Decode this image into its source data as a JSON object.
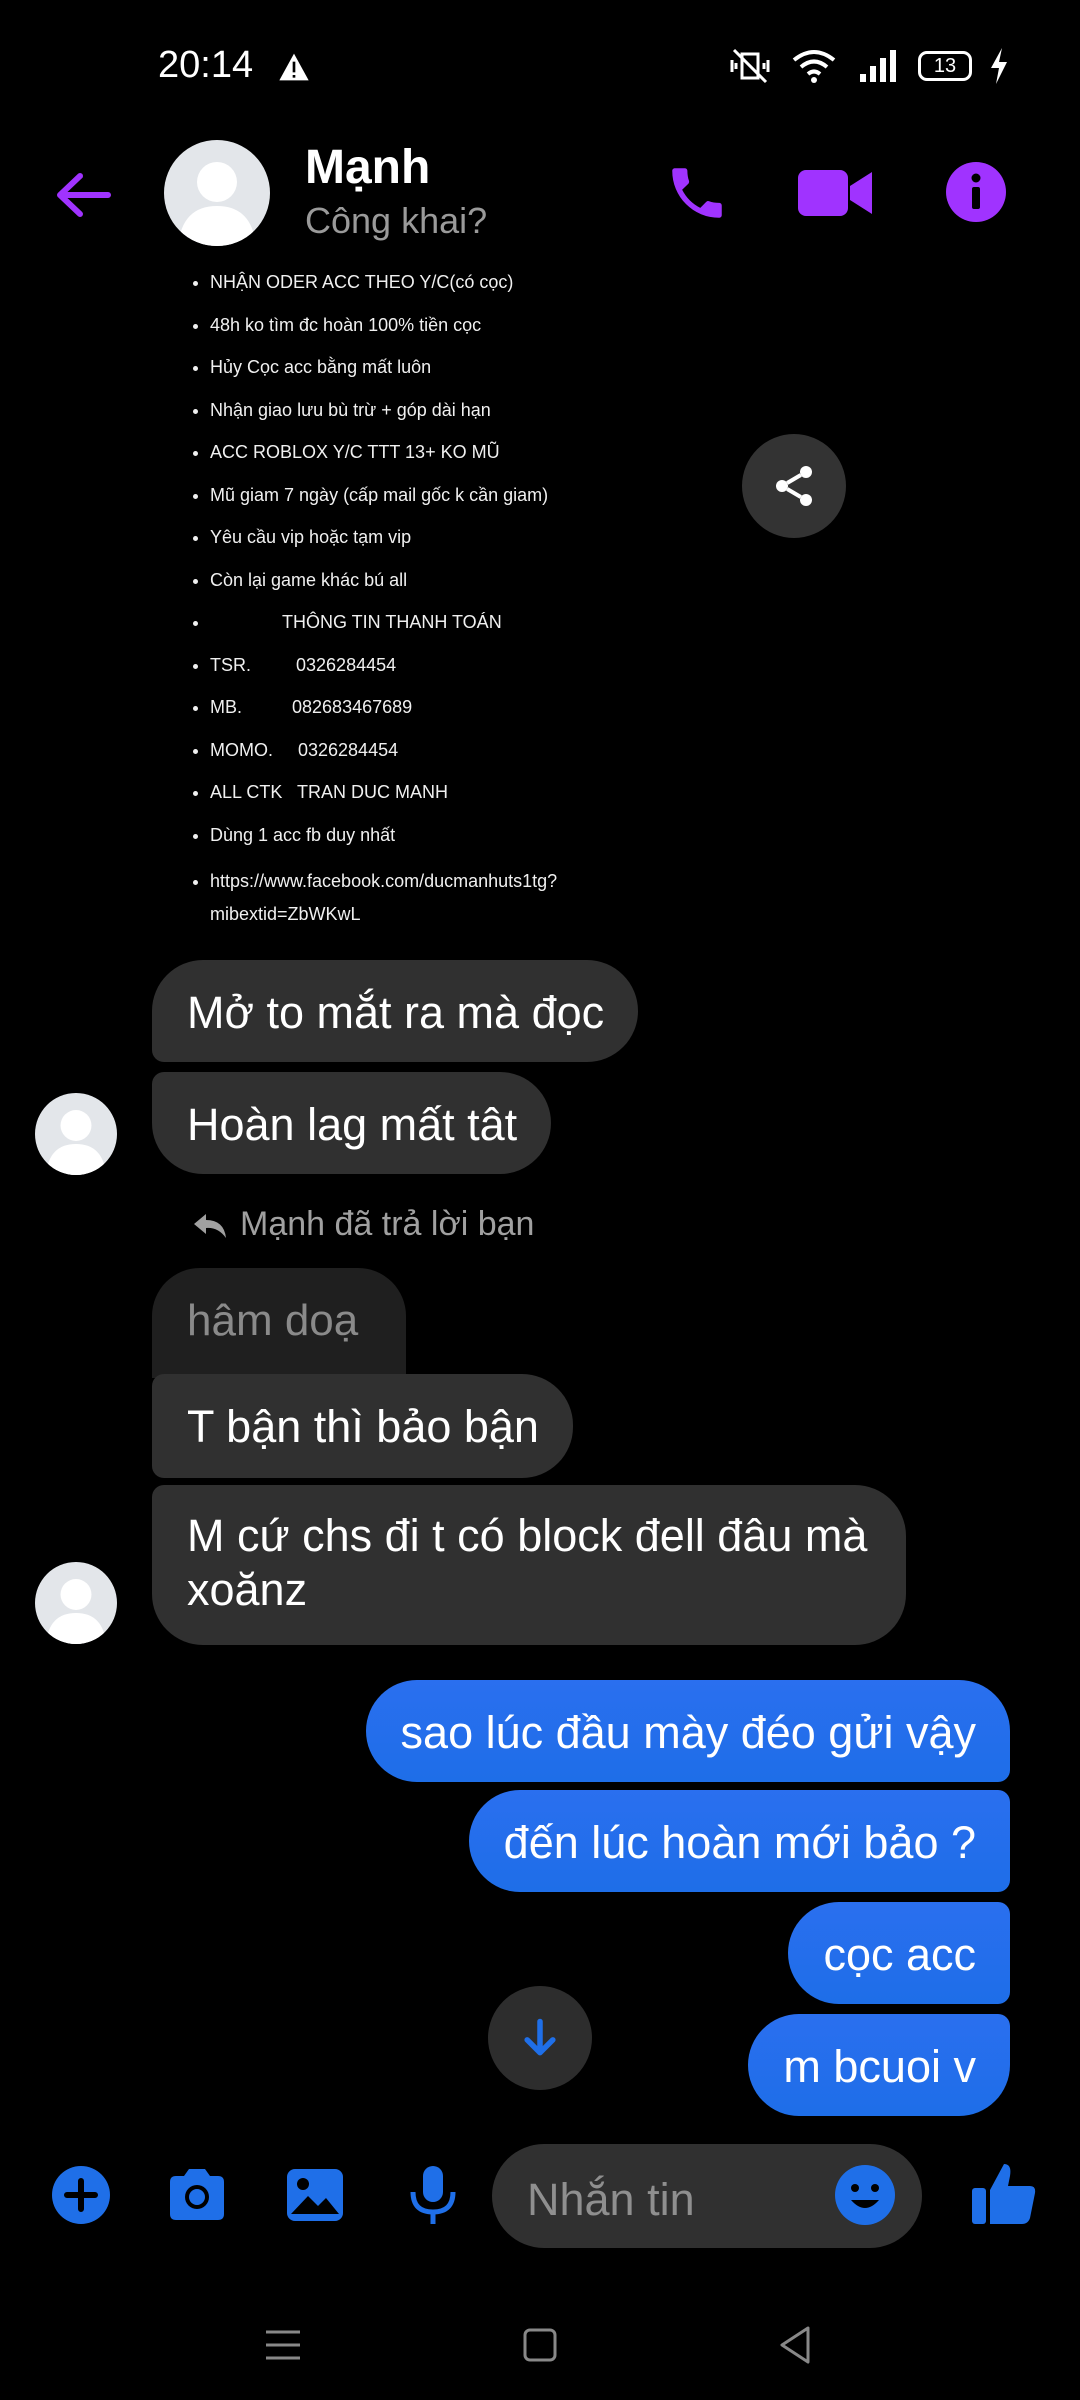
{
  "status_bar": {
    "time": "20:14",
    "battery": "13"
  },
  "header": {
    "name": "Mạnh",
    "subtitle": "Công khai?"
  },
  "shared_post": {
    "lines": [
      "NHẬN ODER ACC THEO Y/C(có cọc)",
      "48h ko tìm đc hoàn 100% tiền cọc",
      "Hủy Cọc acc bằng mất luôn",
      "Nhận giao lưu bù trừ + góp dài hạn",
      "ACC ROBLOX Y/C TTT 13+ KO MŨ",
      "Mũ giam 7 ngày (cấp mail gốc k cần giam)",
      "Yêu cầu vip hoặc tạm vip",
      "Còn lại game khác bú all",
      "THÔNG TIN THANH TOÁN",
      "TSR.         0326284454",
      "MB.          082683467689",
      "MOMO.     0326284454",
      "ALL CTK   TRAN DUC MANH",
      "Dùng 1 acc fb duy nhất",
      "https://www.facebook.com/ducmanhuts1tg?mibextid=ZbWKwL"
    ]
  },
  "messages": {
    "in_1": "Mở to mắt ra mà đọc",
    "in_2": "Hoàn lag mất tât",
    "reply_label": "Mạnh đã trả lời bạn",
    "reply_quote": "hâm doạ",
    "in_3": "T bận thì bảo bận",
    "in_4": "M cứ chs đi t có block đell đâu mà xoănz",
    "out_1": "sao lúc đầu mày đéo gửi vậy",
    "out_2": "đến lúc hoàn mới bảo ?",
    "out_3": "cọc acc",
    "out_4": "m bcuoi v"
  },
  "composer": {
    "placeholder": "Nhắn tin"
  },
  "colors": {
    "accent_purple": "#a033ff",
    "messenger_blue": "#1f6fe8",
    "incoming_bubble": "#303030"
  }
}
